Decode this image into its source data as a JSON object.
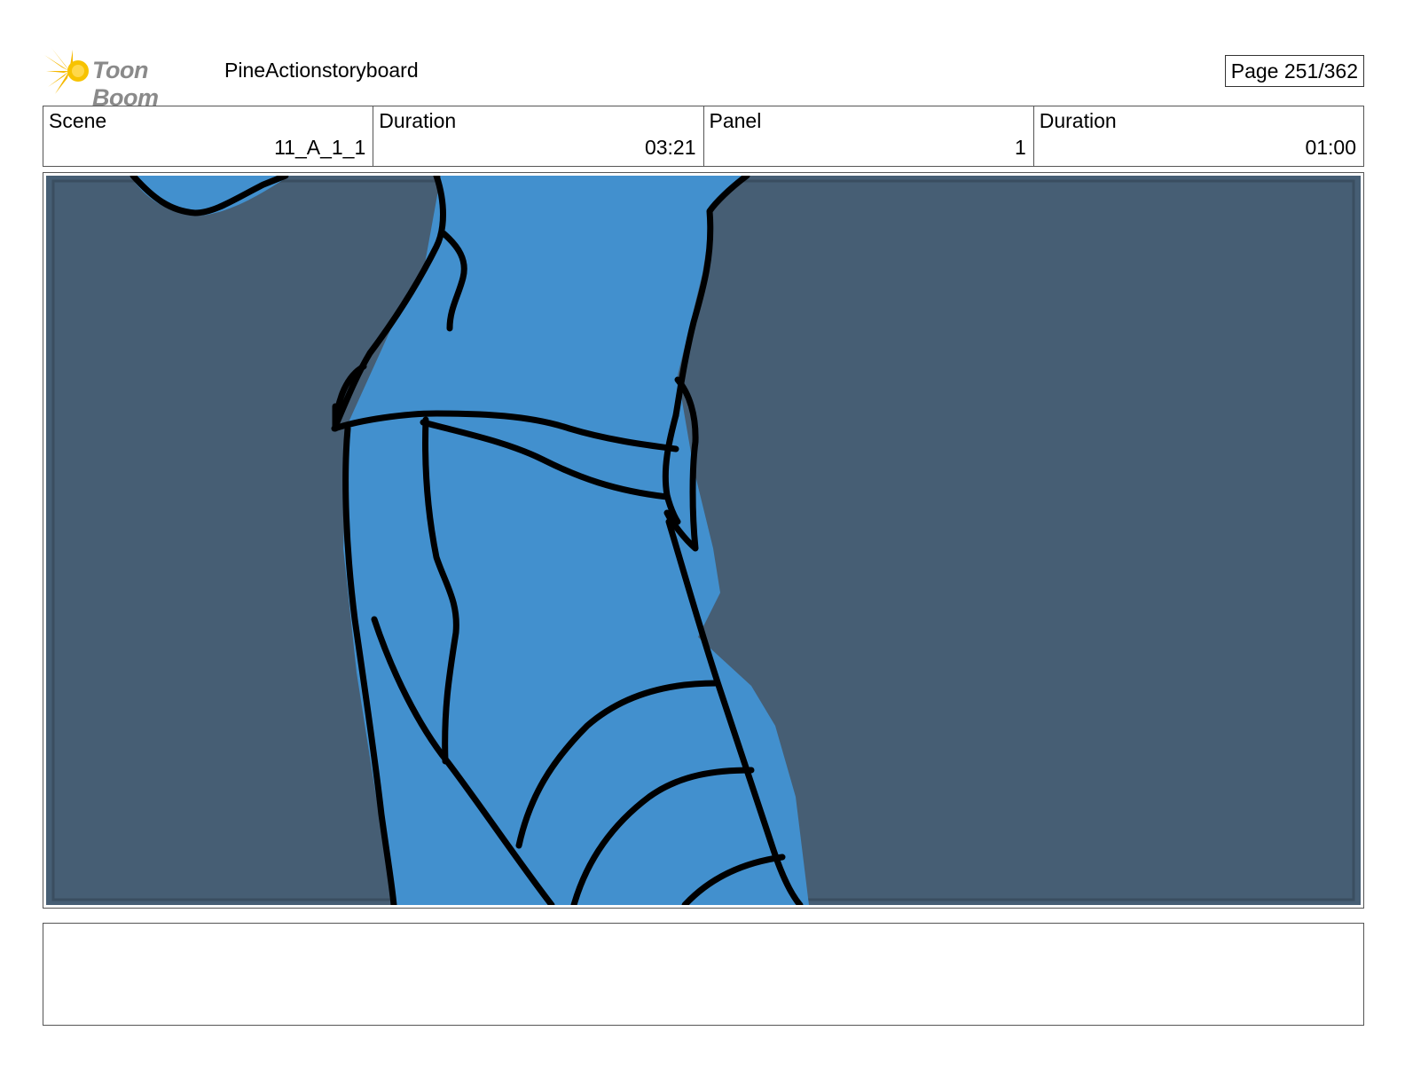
{
  "header": {
    "logo_text": "Toon Boom",
    "project_title": "PineActionstoryboard",
    "page_label": "Page 251/362"
  },
  "info": {
    "scene_label": "Scene",
    "scene_value": "11_A_1_1",
    "scene_duration_label": "Duration",
    "scene_duration_value": "03:21",
    "panel_label": "Panel",
    "panel_value": "1",
    "panel_duration_label": "Duration",
    "panel_duration_value": "01:00"
  },
  "colors": {
    "background_slate": "#465e74",
    "character_blue": "#4290ce",
    "ink": "#000000",
    "logo_yellow": "#f5b800"
  },
  "notes": {
    "text": ""
  }
}
